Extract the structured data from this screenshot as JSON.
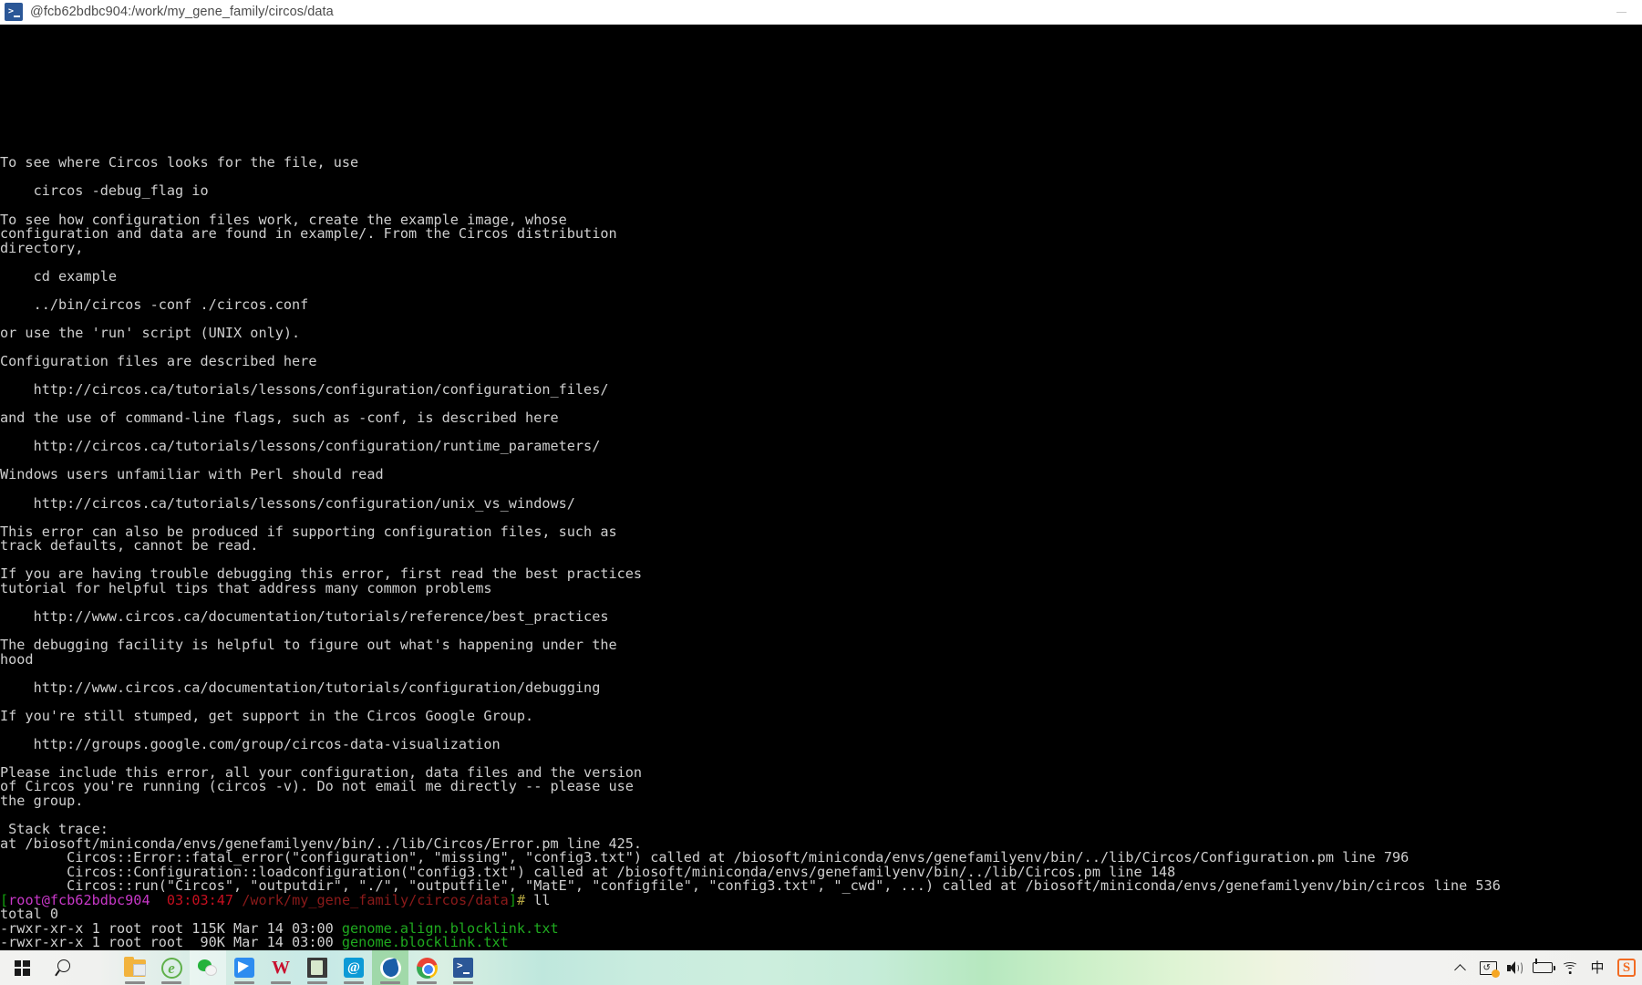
{
  "window": {
    "icon": "powershell-icon",
    "title": "@fcb62bdbc904:/work/my_gene_family/circos/data",
    "minimize_label": "—"
  },
  "terminal": {
    "background": "#000000",
    "foreground": "#cfcfcf",
    "lines": [
      {
        "segments": [
          {
            "text": "To see where Circos looks for the file, use",
            "color": "white"
          }
        ]
      },
      {
        "segments": [
          {
            "text": "",
            "color": "white"
          }
        ]
      },
      {
        "segments": [
          {
            "text": "    circos -debug_flag io",
            "color": "white"
          }
        ]
      },
      {
        "segments": [
          {
            "text": "",
            "color": "white"
          }
        ]
      },
      {
        "segments": [
          {
            "text": "To see how configuration files work, create the example image, whose",
            "color": "white"
          }
        ]
      },
      {
        "segments": [
          {
            "text": "configuration and data are found in example/. From the Circos distribution",
            "color": "white"
          }
        ]
      },
      {
        "segments": [
          {
            "text": "directory,",
            "color": "white"
          }
        ]
      },
      {
        "segments": [
          {
            "text": "",
            "color": "white"
          }
        ]
      },
      {
        "segments": [
          {
            "text": "    cd example",
            "color": "white"
          }
        ]
      },
      {
        "segments": [
          {
            "text": "",
            "color": "white"
          }
        ]
      },
      {
        "segments": [
          {
            "text": "    ../bin/circos -conf ./circos.conf",
            "color": "white"
          }
        ]
      },
      {
        "segments": [
          {
            "text": "",
            "color": "white"
          }
        ]
      },
      {
        "segments": [
          {
            "text": "or use the 'run' script (UNIX only).",
            "color": "white"
          }
        ]
      },
      {
        "segments": [
          {
            "text": "",
            "color": "white"
          }
        ]
      },
      {
        "segments": [
          {
            "text": "Configuration files are described here",
            "color": "white"
          }
        ]
      },
      {
        "segments": [
          {
            "text": "",
            "color": "white"
          }
        ]
      },
      {
        "segments": [
          {
            "text": "    http://circos.ca/tutorials/lessons/configuration/configuration_files/",
            "color": "white"
          }
        ]
      },
      {
        "segments": [
          {
            "text": "",
            "color": "white"
          }
        ]
      },
      {
        "segments": [
          {
            "text": "and the use of command-line flags, such as -conf, is described here",
            "color": "white"
          }
        ]
      },
      {
        "segments": [
          {
            "text": "",
            "color": "white"
          }
        ]
      },
      {
        "segments": [
          {
            "text": "    http://circos.ca/tutorials/lessons/configuration/runtime_parameters/",
            "color": "white"
          }
        ]
      },
      {
        "segments": [
          {
            "text": "",
            "color": "white"
          }
        ]
      },
      {
        "segments": [
          {
            "text": "Windows users unfamiliar with Perl should read",
            "color": "white"
          }
        ]
      },
      {
        "segments": [
          {
            "text": "",
            "color": "white"
          }
        ]
      },
      {
        "segments": [
          {
            "text": "    http://circos.ca/tutorials/lessons/configuration/unix_vs_windows/",
            "color": "white"
          }
        ]
      },
      {
        "segments": [
          {
            "text": "",
            "color": "white"
          }
        ]
      },
      {
        "segments": [
          {
            "text": "This error can also be produced if supporting configuration files, such as",
            "color": "white"
          }
        ]
      },
      {
        "segments": [
          {
            "text": "track defaults, cannot be read.",
            "color": "white"
          }
        ]
      },
      {
        "segments": [
          {
            "text": "",
            "color": "white"
          }
        ]
      },
      {
        "segments": [
          {
            "text": "If you are having trouble debugging this error, first read the best practices",
            "color": "white"
          }
        ]
      },
      {
        "segments": [
          {
            "text": "tutorial for helpful tips that address many common problems",
            "color": "white"
          }
        ]
      },
      {
        "segments": [
          {
            "text": "",
            "color": "white"
          }
        ]
      },
      {
        "segments": [
          {
            "text": "    http://www.circos.ca/documentation/tutorials/reference/best_practices",
            "color": "white"
          }
        ]
      },
      {
        "segments": [
          {
            "text": "",
            "color": "white"
          }
        ]
      },
      {
        "segments": [
          {
            "text": "The debugging facility is helpful to figure out what's happening under the",
            "color": "white"
          }
        ]
      },
      {
        "segments": [
          {
            "text": "hood",
            "color": "white"
          }
        ]
      },
      {
        "segments": [
          {
            "text": "",
            "color": "white"
          }
        ]
      },
      {
        "segments": [
          {
            "text": "    http://www.circos.ca/documentation/tutorials/configuration/debugging",
            "color": "white"
          }
        ]
      },
      {
        "segments": [
          {
            "text": "",
            "color": "white"
          }
        ]
      },
      {
        "segments": [
          {
            "text": "If you're still stumped, get support in the Circos Google Group.",
            "color": "white"
          }
        ]
      },
      {
        "segments": [
          {
            "text": "",
            "color": "white"
          }
        ]
      },
      {
        "segments": [
          {
            "text": "    http://groups.google.com/group/circos-data-visualization",
            "color": "white"
          }
        ]
      },
      {
        "segments": [
          {
            "text": "",
            "color": "white"
          }
        ]
      },
      {
        "segments": [
          {
            "text": "Please include this error, all your configuration, data files and the version",
            "color": "white"
          }
        ]
      },
      {
        "segments": [
          {
            "text": "of Circos you're running (circos -v). Do not email me directly -- please use",
            "color": "white"
          }
        ]
      },
      {
        "segments": [
          {
            "text": "the group.",
            "color": "white"
          }
        ]
      },
      {
        "segments": [
          {
            "text": "",
            "color": "white"
          }
        ]
      },
      {
        "segments": [
          {
            "text": " Stack trace:",
            "color": "white"
          }
        ]
      },
      {
        "segments": [
          {
            "text": "at /biosoft/miniconda/envs/genefamilyenv/bin/../lib/Circos/Error.pm line 425.",
            "color": "white"
          }
        ]
      },
      {
        "segments": [
          {
            "text": "        Circos::Error::fatal_error(\"configuration\", \"missing\", \"config3.txt\") called at /biosoft/miniconda/envs/genefamilyenv/bin/../lib/Circos/Configuration.pm line 796",
            "color": "white"
          }
        ]
      },
      {
        "segments": [
          {
            "text": "        Circos::Configuration::loadconfiguration(\"config3.txt\") called at /biosoft/miniconda/envs/genefamilyenv/bin/../lib/Circos.pm line 148",
            "color": "white"
          }
        ]
      },
      {
        "segments": [
          {
            "text": "        Circos::run(\"Circos\", \"outputdir\", \"./\", \"outputfile\", \"MatE\", \"configfile\", \"config3.txt\", \"_cwd\", ...) called at /biosoft/miniconda/envs/genefamilyenv/bin/circos line 536",
            "color": "white"
          }
        ]
      },
      {
        "segments": [
          {
            "text": "[",
            "color": "green"
          },
          {
            "text": "root@fcb62bdbc904",
            "color": "magenta"
          },
          {
            "text": "  ",
            "color": "white"
          },
          {
            "text": "03:03:47",
            "color": "red"
          },
          {
            "text": " ",
            "color": "white"
          },
          {
            "text": "/work/my_gene_family/circos/data",
            "color": "darkred"
          },
          {
            "text": "]",
            "color": "green"
          },
          {
            "text": "#",
            "color": "yellow"
          },
          {
            "text": " ll",
            "color": "white"
          }
        ]
      },
      {
        "segments": [
          {
            "text": "total 0",
            "color": "white"
          }
        ]
      },
      {
        "segments": [
          {
            "text": "-rwxr-xr-x 1 root root 115K Mar 14 03:00 ",
            "color": "white"
          },
          {
            "text": "genome.align.blocklink.txt",
            "color": "fgreen"
          }
        ]
      },
      {
        "segments": [
          {
            "text": "-rwxr-xr-x 1 root root  90K Mar 14 03:00 ",
            "color": "white"
          },
          {
            "text": "genome.blocklink.txt",
            "color": "fgreen"
          }
        ]
      }
    ]
  },
  "taskbar": {
    "start": {
      "name": "start-button",
      "icon": "windows-logo-icon"
    },
    "search": {
      "name": "search-button",
      "icon": "search-icon"
    },
    "apps": [
      {
        "name": "taskbar-file-explorer",
        "icon": "folder-icon",
        "label": "File Explorer",
        "state": "running"
      },
      {
        "name": "taskbar-edge",
        "icon": "edge-icon",
        "label": "Microsoft Edge",
        "state": "running"
      },
      {
        "name": "taskbar-wechat",
        "icon": "wechat-icon",
        "label": "WeChat",
        "state": "hot"
      },
      {
        "name": "taskbar-bird-app",
        "icon": "blue-bird-icon",
        "label": "Feishu",
        "state": "running"
      },
      {
        "name": "taskbar-wps",
        "icon": "wps-icon",
        "label": "WPS Office",
        "state": "running"
      },
      {
        "name": "taskbar-notepad",
        "icon": "dark-document-icon",
        "label": "Editor",
        "state": "running"
      },
      {
        "name": "taskbar-at-app",
        "icon": "at-blue-icon",
        "label": "CAD",
        "state": "running"
      },
      {
        "name": "taskbar-sogou-browser",
        "icon": "sogou-browser-icon",
        "label": "Sogou Browser",
        "state": "active"
      },
      {
        "name": "taskbar-chrome",
        "icon": "chrome-icon",
        "label": "Google Chrome",
        "state": "running"
      },
      {
        "name": "taskbar-powershell",
        "icon": "powershell-icon",
        "label": "PowerShell",
        "state": "running"
      }
    ],
    "tray": [
      {
        "name": "tray-show-hidden-icons",
        "icon": "chevron-up-icon"
      },
      {
        "name": "tray-screen-capture",
        "icon": "screen-icon"
      },
      {
        "name": "tray-volume",
        "icon": "speaker-icon"
      },
      {
        "name": "tray-battery",
        "icon": "battery-charging-icon"
      },
      {
        "name": "tray-network",
        "icon": "wifi-icon"
      },
      {
        "name": "tray-ime-mode",
        "icon": "ime-chinese-icon",
        "glyph": "中"
      },
      {
        "name": "tray-sogou-input",
        "icon": "sogou-logo-icon",
        "glyph": "S"
      }
    ]
  },
  "colors": {
    "terminal_bg": "#000000",
    "terminal_fg": "#cfcfcf",
    "prompt_user": "#c838c8",
    "prompt_time": "#c50f1f",
    "prompt_path": "#8b1a1a",
    "prompt_bracket": "#13a10e",
    "prompt_hash": "#b5a642",
    "file_exec": "#1faa1f",
    "titlebar_bg": "#ffffff",
    "titlebar_fg": "#4c4c4c"
  }
}
